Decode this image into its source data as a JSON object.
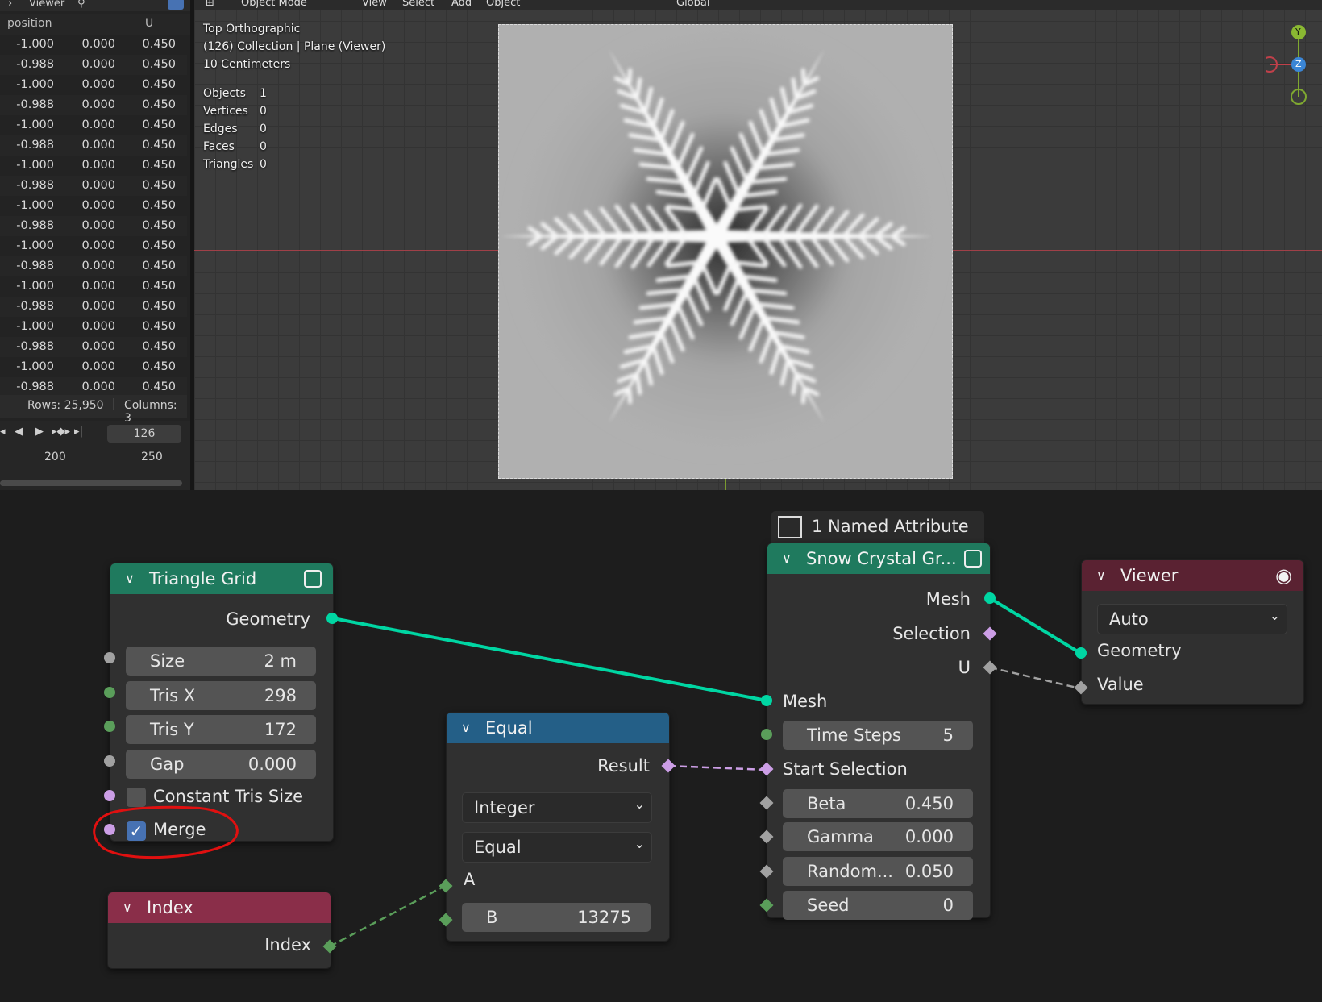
{
  "spreadsheet": {
    "title": "Viewer",
    "columns": [
      "position",
      "U"
    ],
    "rows": [
      [
        "-1.000",
        "0.000",
        "0.450"
      ],
      [
        "-0.988",
        "0.000",
        "0.450"
      ],
      [
        "-1.000",
        "0.000",
        "0.450"
      ],
      [
        "-0.988",
        "0.000",
        "0.450"
      ],
      [
        "-1.000",
        "0.000",
        "0.450"
      ],
      [
        "-0.988",
        "0.000",
        "0.450"
      ],
      [
        "-1.000",
        "0.000",
        "0.450"
      ],
      [
        "-0.988",
        "0.000",
        "0.450"
      ],
      [
        "-1.000",
        "0.000",
        "0.450"
      ],
      [
        "-0.988",
        "0.000",
        "0.450"
      ],
      [
        "-1.000",
        "0.000",
        "0.450"
      ],
      [
        "-0.988",
        "0.000",
        "0.450"
      ],
      [
        "-1.000",
        "0.000",
        "0.450"
      ],
      [
        "-0.988",
        "0.000",
        "0.450"
      ],
      [
        "-1.000",
        "0.000",
        "0.450"
      ],
      [
        "-0.988",
        "0.000",
        "0.450"
      ],
      [
        "-1.000",
        "0.000",
        "0.450"
      ],
      [
        "-0.988",
        "0.000",
        "0.450"
      ]
    ],
    "rows_label": "Rows: 25,950",
    "columns_label": "Columns: 3"
  },
  "timeline": {
    "frame": "126",
    "ticks": [
      "200",
      "250"
    ]
  },
  "viewport": {
    "header": {
      "mode": "Object Mode",
      "menus": [
        "View",
        "Select",
        "Add",
        "Object"
      ],
      "orientation": "Global"
    },
    "overlay": {
      "view": "Top Orthographic",
      "collection": "(126) Collection | Plane (Viewer)",
      "scale": "10 Centimeters"
    },
    "stats": [
      {
        "label": "Objects",
        "value": "1"
      },
      {
        "label": "Vertices",
        "value": "0"
      },
      {
        "label": "Edges",
        "value": "0"
      },
      {
        "label": "Faces",
        "value": "0"
      },
      {
        "label": "Triangles",
        "value": "0"
      }
    ],
    "gizmo": {
      "y": "Y",
      "z": "Z"
    }
  },
  "nodes": {
    "triangle_grid": {
      "title": "Triangle Grid",
      "output": "Geometry",
      "fields": [
        {
          "label": "Size",
          "value": "2 m"
        },
        {
          "label": "Tris X",
          "value": "298"
        },
        {
          "label": "Tris Y",
          "value": "172"
        },
        {
          "label": "Gap",
          "value": "0.000"
        }
      ],
      "constant_tris_size": "Constant Tris Size",
      "merge": "Merge",
      "merge_checked": true
    },
    "index": {
      "title": "Index",
      "output": "Index"
    },
    "equal": {
      "title": "Equal",
      "output": "Result",
      "type": "Integer",
      "operation": "Equal",
      "input_a": "A",
      "input_b_label": "B",
      "input_b_value": "13275"
    },
    "snow_crystal": {
      "badge": "1 Named Attribute",
      "title": "Snow Crystal Gr...",
      "outputs": [
        "Mesh",
        "Selection",
        "U"
      ],
      "input_mesh": "Mesh",
      "fields": [
        {
          "label": "Time Steps",
          "value": "5"
        },
        {
          "label": "Beta",
          "value": "0.450"
        },
        {
          "label": "Gamma",
          "value": "0.000"
        },
        {
          "label": "Random...",
          "value": "0.050"
        },
        {
          "label": "Seed",
          "value": "0"
        }
      ],
      "start_selection": "Start Selection"
    },
    "viewer": {
      "title": "Viewer",
      "domain": "Auto",
      "inputs": [
        "Geometry",
        "Value"
      ]
    }
  },
  "colors": {
    "geometry_socket": "#00d6a3",
    "bool_socket": "#cc9ee6",
    "int_socket": "#5a9e5a",
    "float_socket": "#a1a1a1",
    "geo_header": "#1f7a5e",
    "input_header": "#8a2e49",
    "util_header": "#245f87",
    "output_header": "#5a2232",
    "annotation": "#e01010"
  }
}
